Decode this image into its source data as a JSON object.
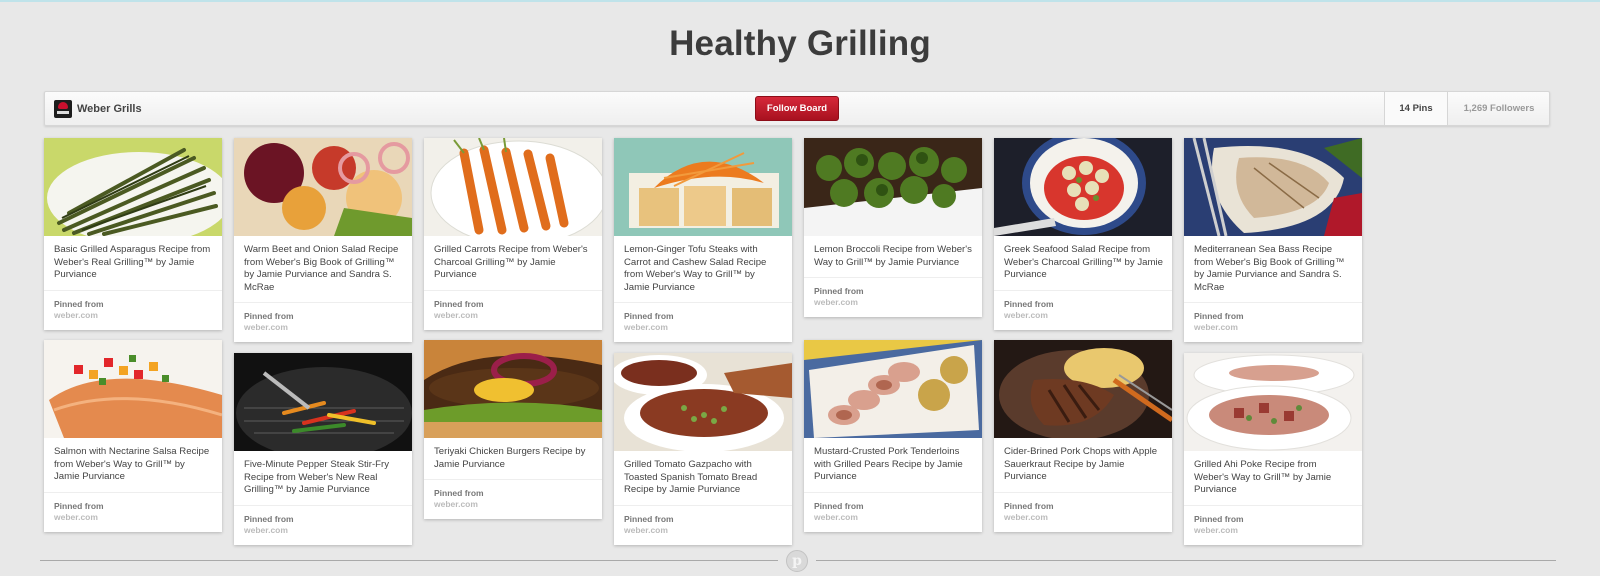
{
  "board": {
    "title": "Healthy Grilling",
    "owner": "Weber Grills",
    "follow_label": "Follow Board",
    "pins_count": "14 Pins",
    "followers_count": "1,269 Followers"
  },
  "colors": {
    "follow_button": "#c8192a",
    "page_background": "#e8e8e8"
  },
  "footer_icon": "pinterest-logo-icon",
  "pins": [
    {
      "desc": "Basic Grilled Asparagus Recipe from Weber's Real Grilling™ by Jamie Purviance",
      "source_label": "Pinned from",
      "source": "weber.com"
    },
    {
      "desc": "Warm Beet and Onion Salad Recipe from Weber's Big Book of Grilling™ by Jamie Purviance and Sandra S. McRae",
      "source_label": "Pinned from",
      "source": "weber.com"
    },
    {
      "desc": "Grilled Carrots Recipe from Weber's Charcoal Grilling™ by Jamie Purviance",
      "source_label": "Pinned from",
      "source": "weber.com"
    },
    {
      "desc": "Lemon-Ginger Tofu Steaks with Carrot and Cashew Salad Recipe from Weber's Way to Grill™ by Jamie Purviance",
      "source_label": "Pinned from",
      "source": "weber.com"
    },
    {
      "desc": "Lemon Broccoli Recipe from Weber's Way to Grill™ by Jamie Purviance",
      "source_label": "Pinned from",
      "source": "weber.com"
    },
    {
      "desc": "Greek Seafood Salad Recipe from Weber's Charcoal Grilling™ by Jamie Purviance",
      "source_label": "Pinned from",
      "source": "weber.com"
    },
    {
      "desc": "Mediterranean Sea Bass Recipe from Weber's Big Book of Grilling™ by Jamie Purviance and Sandra S. McRae",
      "source_label": "Pinned from",
      "source": "weber.com"
    },
    {
      "desc": "Salmon with Nectarine Salsa Recipe from Weber's Way to Grill™ by Jamie Purviance",
      "source_label": "Pinned from",
      "source": "weber.com"
    },
    {
      "desc": "Five-Minute Pepper Steak Stir-Fry Recipe from Weber's New Real Grilling™ by Jamie Purviance",
      "source_label": "Pinned from",
      "source": "weber.com"
    },
    {
      "desc": "Teriyaki Chicken Burgers Recipe by Jamie Purviance",
      "source_label": "Pinned from",
      "source": "weber.com"
    },
    {
      "desc": "Grilled Tomato Gazpacho with Toasted Spanish Tomato Bread Recipe by Jamie Purviance",
      "source_label": "Pinned from",
      "source": "weber.com"
    },
    {
      "desc": "Mustard-Crusted Pork Tenderloins with Grilled Pears Recipe by Jamie Purviance",
      "source_label": "Pinned from",
      "source": "weber.com"
    },
    {
      "desc": "Cider-Brined Pork Chops with Apple Sauerkraut Recipe by Jamie Purviance",
      "source_label": "Pinned from",
      "source": "weber.com"
    },
    {
      "desc": "Grilled Ahi Poke Recipe from Weber's Way to Grill™ by Jamie Purviance",
      "source_label": "Pinned from",
      "source": "weber.com"
    }
  ]
}
